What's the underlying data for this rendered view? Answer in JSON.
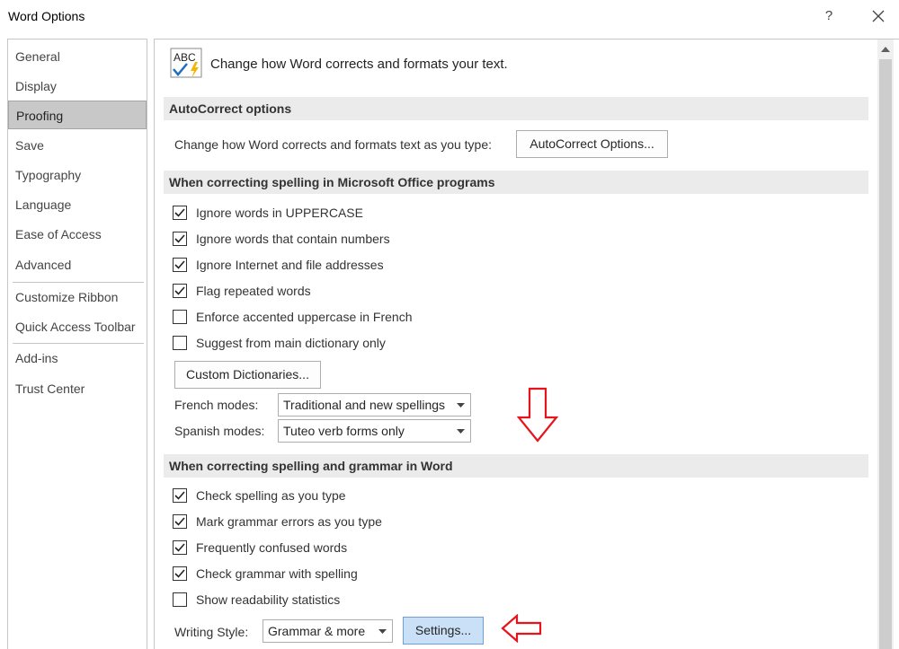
{
  "window": {
    "title": "Word Options",
    "help_label": "?"
  },
  "sidebar": {
    "items": [
      {
        "label": "General"
      },
      {
        "label": "Display"
      },
      {
        "label": "Proofing"
      },
      {
        "label": "Save"
      },
      {
        "label": "Typography"
      },
      {
        "label": "Language"
      },
      {
        "label": "Ease of Access"
      },
      {
        "label": "Advanced"
      },
      {
        "label": "Customize Ribbon"
      },
      {
        "label": "Quick Access Toolbar"
      },
      {
        "label": "Add-ins"
      },
      {
        "label": "Trust Center"
      }
    ],
    "selected": "Proofing"
  },
  "header": {
    "icon_text": "ABC",
    "text": "Change how Word corrects and formats your text."
  },
  "autocorrect": {
    "title": "AutoCorrect options",
    "description": "Change how Word corrects and formats text as you type:",
    "button_label": "AutoCorrect Options..."
  },
  "office_spelling": {
    "title": "When correcting spelling in Microsoft Office programs",
    "options": [
      {
        "label": "Ignore words in UPPERCASE",
        "checked": true
      },
      {
        "label": "Ignore words that contain numbers",
        "checked": true
      },
      {
        "label": "Ignore Internet and file addresses",
        "checked": true
      },
      {
        "label": "Flag repeated words",
        "checked": true
      },
      {
        "label": "Enforce accented uppercase in French",
        "checked": false
      },
      {
        "label": "Suggest from main dictionary only",
        "checked": false
      }
    ],
    "custom_dictionaries_label": "Custom Dictionaries...",
    "french_modes_label": "French modes:",
    "french_modes_value": "Traditional and new spellings",
    "spanish_modes_label": "Spanish modes:",
    "spanish_modes_value": "Tuteo verb forms only"
  },
  "word_spelling": {
    "title": "When correcting spelling and grammar in Word",
    "options": [
      {
        "label": "Check spelling as you type",
        "checked": true
      },
      {
        "label": "Mark grammar errors as you type",
        "checked": true
      },
      {
        "label": "Frequently confused words",
        "checked": true
      },
      {
        "label": "Check grammar with spelling",
        "checked": true
      },
      {
        "label": "Show readability statistics",
        "checked": false
      }
    ],
    "writing_style_label": "Writing Style:",
    "writing_style_value": "Grammar & more",
    "settings_label": "Settings..."
  },
  "colors": {
    "selected_nav": "#c8c8c8",
    "section_bar": "#ebebeb",
    "annotation_arrow": "#e8141b",
    "settings_highlight": "#c9e0f7",
    "checkmark_icon": "#1f6fbf",
    "lightning_icon": "#f2b705"
  }
}
